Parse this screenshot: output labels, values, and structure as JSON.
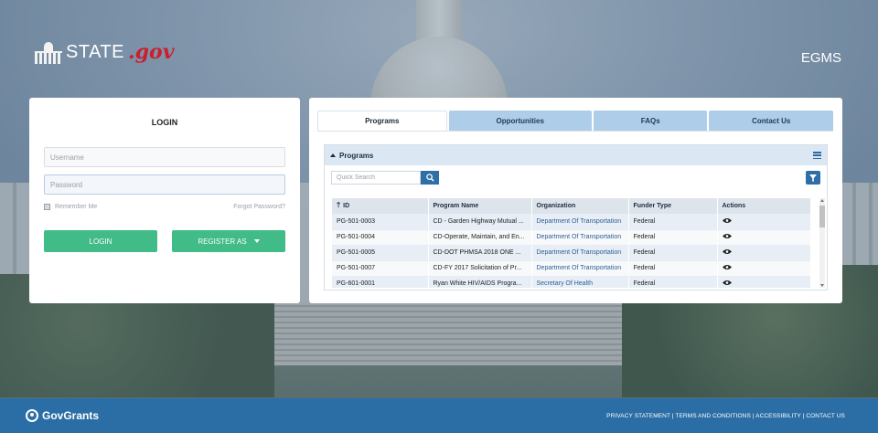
{
  "header": {
    "logo_state": "STATE",
    "logo_gov": ".gov",
    "app_name": "EGMS"
  },
  "login": {
    "title": "LOGIN",
    "username_placeholder": "Username",
    "password_placeholder": "Password",
    "remember_label": "Remember Me",
    "forgot_label": "Forgot Password?",
    "login_button": "LOGIN",
    "register_button": "REGISTER AS"
  },
  "tabs": [
    {
      "label": "Programs",
      "active": true
    },
    {
      "label": "Opportunities"
    },
    {
      "label": "FAQs"
    },
    {
      "label": "Contact Us"
    }
  ],
  "grid": {
    "title": "Programs",
    "search_placeholder": "Quick Search",
    "columns": [
      "ID",
      "Program Name",
      "Organization",
      "Funder Type",
      "Actions"
    ],
    "rows": [
      {
        "id": "PG-501-0003",
        "name": "CD - Garden Highway Mutual ...",
        "org": "Department Of Transportation",
        "funder": "Federal"
      },
      {
        "id": "PG-501-0004",
        "name": "CD-Operate, Maintain, and En...",
        "org": "Department Of Transportation",
        "funder": "Federal"
      },
      {
        "id": "PG-501-0005",
        "name": "CD-DOT PHMSA 2018 ONE ...",
        "org": "Department Of Transportation",
        "funder": "Federal"
      },
      {
        "id": "PG-501-0007",
        "name": "CD-FY 2017 Solicitation of Pr...",
        "org": "Department Of Transportation",
        "funder": "Federal"
      },
      {
        "id": "PG-601-0001",
        "name": "Ryan White HIV/AIDS Progra...",
        "org": "Secretary Of Health",
        "funder": "Federal"
      }
    ]
  },
  "footer": {
    "brand": "GovGrants",
    "links": "PRIVACY STATEMENT | TERMS AND CONDITIONS | ACCESSIBILITY | CONTACT US"
  },
  "colors": {
    "primary_green": "#41bb87",
    "footer_blue": "#2b6ea5",
    "tab_blue": "#aecde9",
    "gov_red": "#c8202f"
  }
}
